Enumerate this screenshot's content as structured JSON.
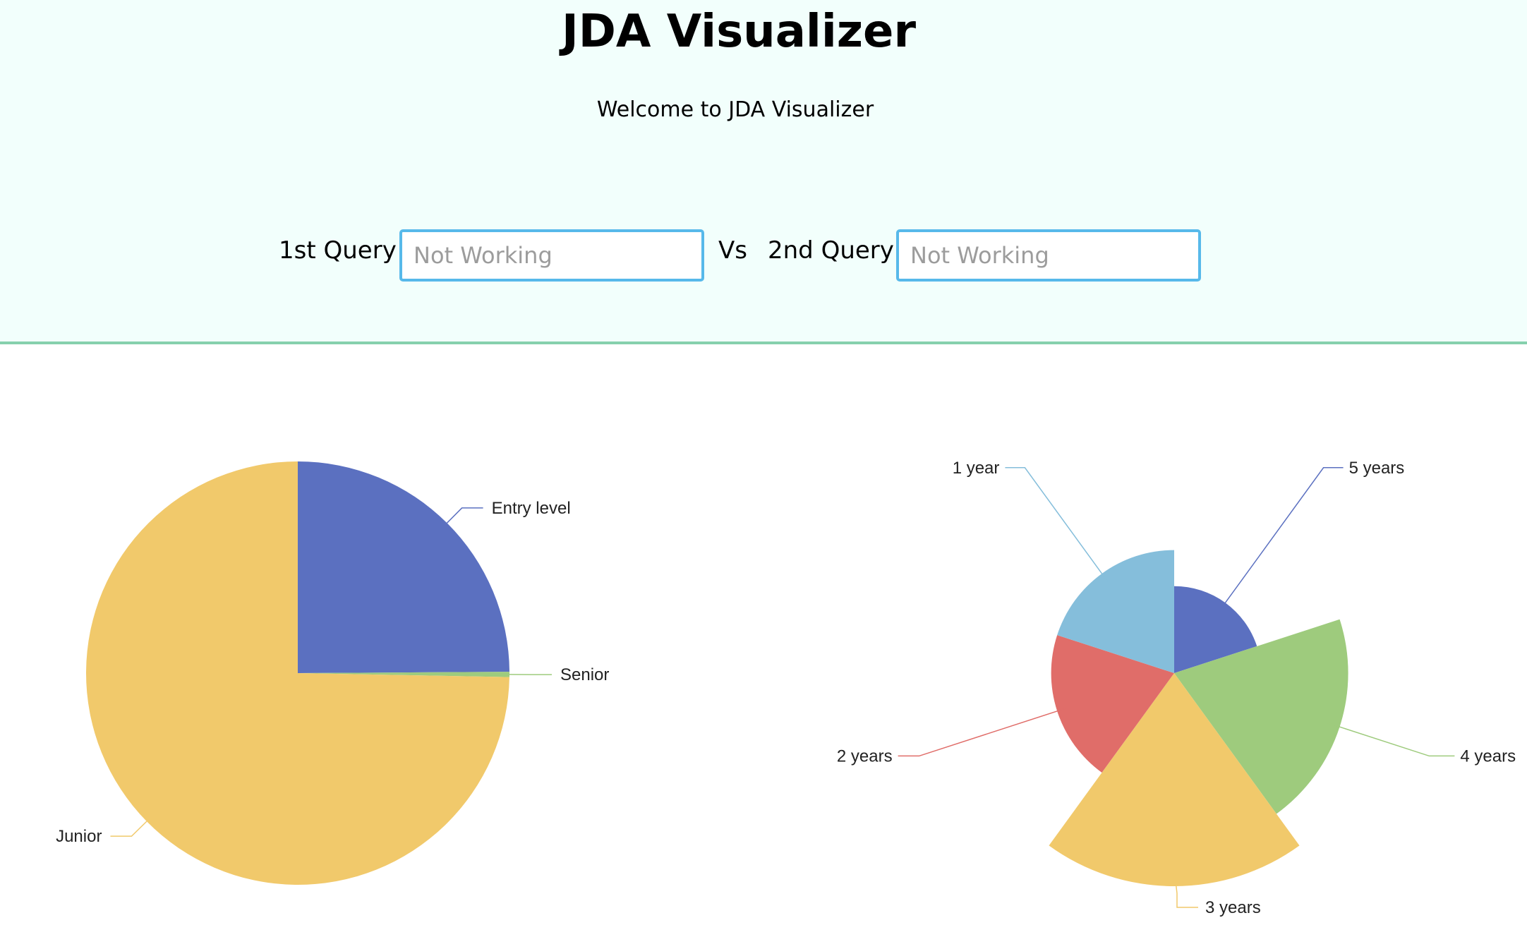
{
  "header": {
    "title": "JDA Visualizer",
    "welcome": "Welcome to JDA Visualizer",
    "query1_label": "1st Query",
    "query1_placeholder": "Not Working",
    "vs_label": "Vs",
    "query2_label": "2nd Query",
    "query2_placeholder": "Not Working",
    "background_color": "#f2fffc",
    "divider_color": "#86d0ad"
  },
  "chart_data": [
    {
      "type": "pie",
      "categories": [
        "Entry level",
        "Senior",
        "Junior"
      ],
      "values": [
        24.9,
        0.4,
        74.7
      ],
      "colors": [
        "#5b70c0",
        "#9ecb7d",
        "#f1c96b"
      ]
    },
    {
      "type": "pie",
      "variant": "rose",
      "categories": [
        "5 years",
        "4 years",
        "3 years",
        "2 years",
        "1 year"
      ],
      "values": [
        1,
        4,
        6,
        2,
        2
      ],
      "colors": [
        "#5b70c0",
        "#9ecb7d",
        "#f1c96b",
        "#e06d69",
        "#85bedb"
      ]
    }
  ]
}
